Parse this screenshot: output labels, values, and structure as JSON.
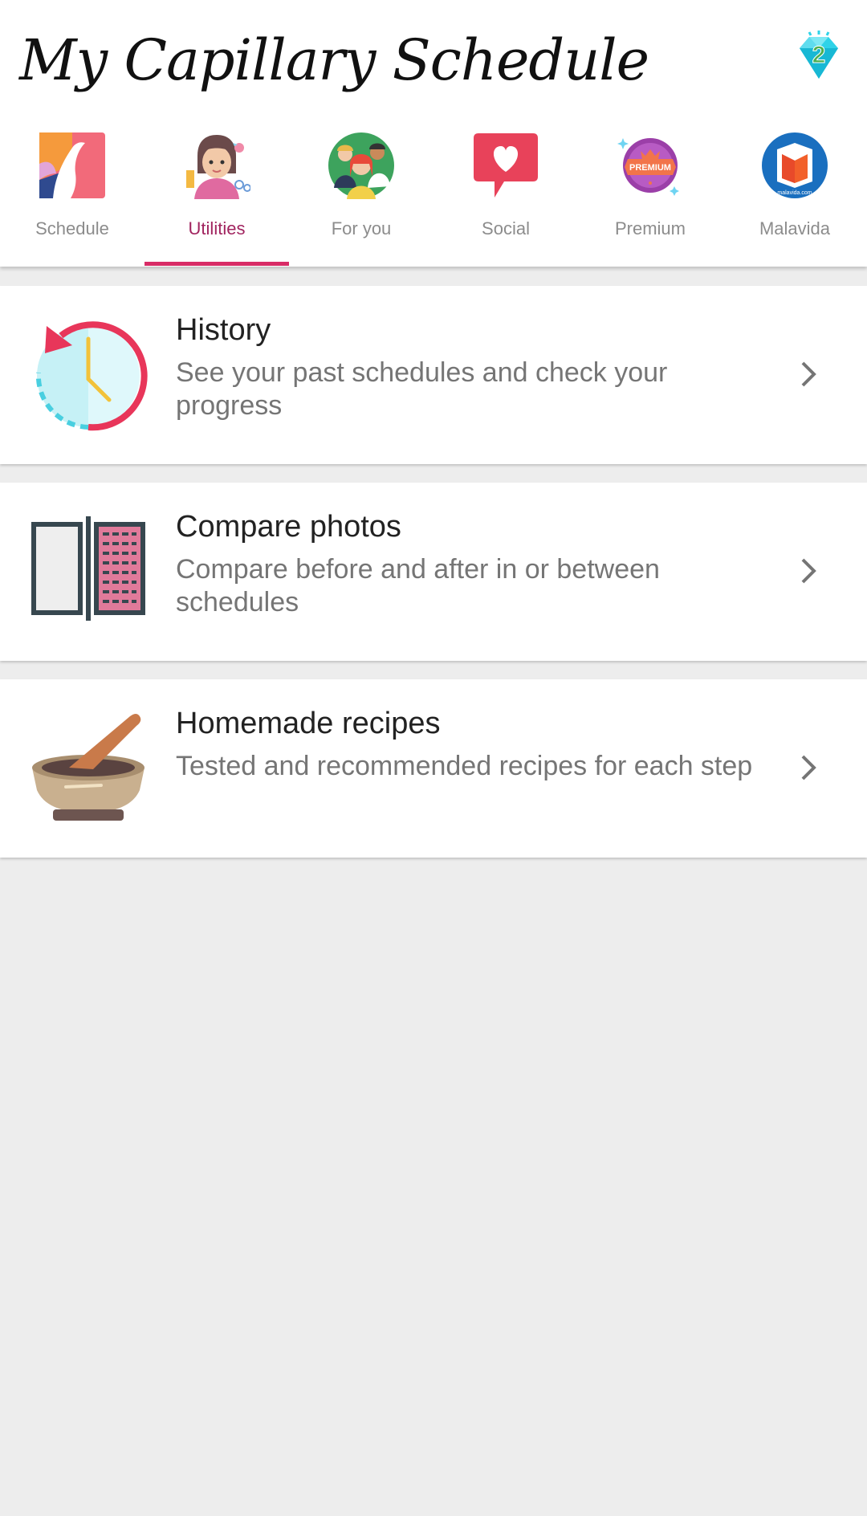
{
  "header": {
    "title": "My Capillary Schedule",
    "gem_badge_count": "2"
  },
  "tabs": [
    {
      "label": "Schedule",
      "icon": "schedule-icon",
      "active": false
    },
    {
      "label": "Utilities",
      "icon": "utilities-icon",
      "active": true
    },
    {
      "label": "For you",
      "icon": "for-you-icon",
      "active": false
    },
    {
      "label": "Social",
      "icon": "social-icon",
      "active": false
    },
    {
      "label": "Premium",
      "icon": "premium-icon",
      "active": false,
      "badge_text": "PREMIUM"
    },
    {
      "label": "Malavida",
      "icon": "malavida-icon",
      "active": false,
      "badge_text": "malavida.com"
    }
  ],
  "utilities": [
    {
      "title": "History",
      "description": "See your past schedules and check your progress",
      "icon": "history-clock-icon"
    },
    {
      "title": "Compare photos",
      "description": "Compare before and after in or between schedules",
      "icon": "compare-photos-icon"
    },
    {
      "title": "Homemade recipes",
      "description": "Tested and recommended recipes for each step",
      "icon": "mortar-pestle-icon"
    }
  ],
  "colors": {
    "accent": "#d82c66",
    "active_label": "#a1245f",
    "inactive_label": "#8c8c8c",
    "background": "#ededed"
  }
}
